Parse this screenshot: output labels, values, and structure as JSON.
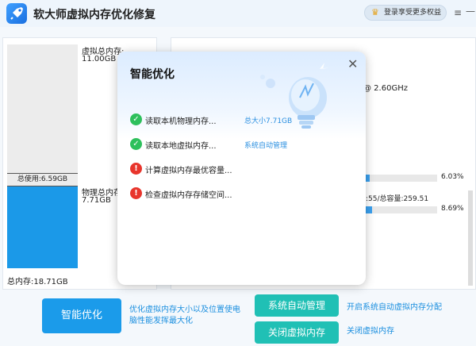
{
  "app": {
    "title": "软大师虚拟内存优化修复",
    "vip_label": "登录享受更多权益",
    "menu_glyph": "≡",
    "minimize_glyph": "—"
  },
  "memory": {
    "virtual_total_label": "虚拟总内存:",
    "virtual_total_value": "11.00GB",
    "used_label": "总使用:6.59GB",
    "physical_total_label": "物理总内存:",
    "physical_total_value": "7.71GB",
    "total_label": "总内存:18.71GB"
  },
  "info": {
    "cpu_freq": "@ 2.60GHz",
    "progress1_value": "6.03%",
    "progress1_fraction": 0.0603,
    "virtual_mem_info": ":55/总容量:259.51",
    "progress2_value": "8.69%",
    "progress2_fraction": 0.0869
  },
  "actions": {
    "optimize_label": "智能优化",
    "optimize_desc": "优化虚拟内存大小以及位置使电脑性能发挥最大化",
    "auto_label": "系统自动管理",
    "auto_desc": "开启系统自动虚拟内存分配",
    "close_label": "关闭虚拟内存",
    "close_desc": "关闭虚拟内存"
  },
  "dialog": {
    "title": "智能优化",
    "close_glyph": "✕",
    "steps": [
      {
        "label": "读取本机物理内存...",
        "status": "总大小7.71GB",
        "icon": "check"
      },
      {
        "label": "读取本地虚拟内存...",
        "status": "系统自动管理",
        "icon": "check"
      },
      {
        "label": "计算虚拟内存最优容量...",
        "status": "",
        "icon": "exclamation"
      },
      {
        "label": "检查虚拟内存存储空间...",
        "status": "",
        "icon": "exclamation"
      }
    ]
  },
  "colors": {
    "accent_blue": "#1b9bea",
    "teal": "#20c0b5",
    "ok_green": "#2ec05c",
    "warn_red": "#e8352c"
  }
}
